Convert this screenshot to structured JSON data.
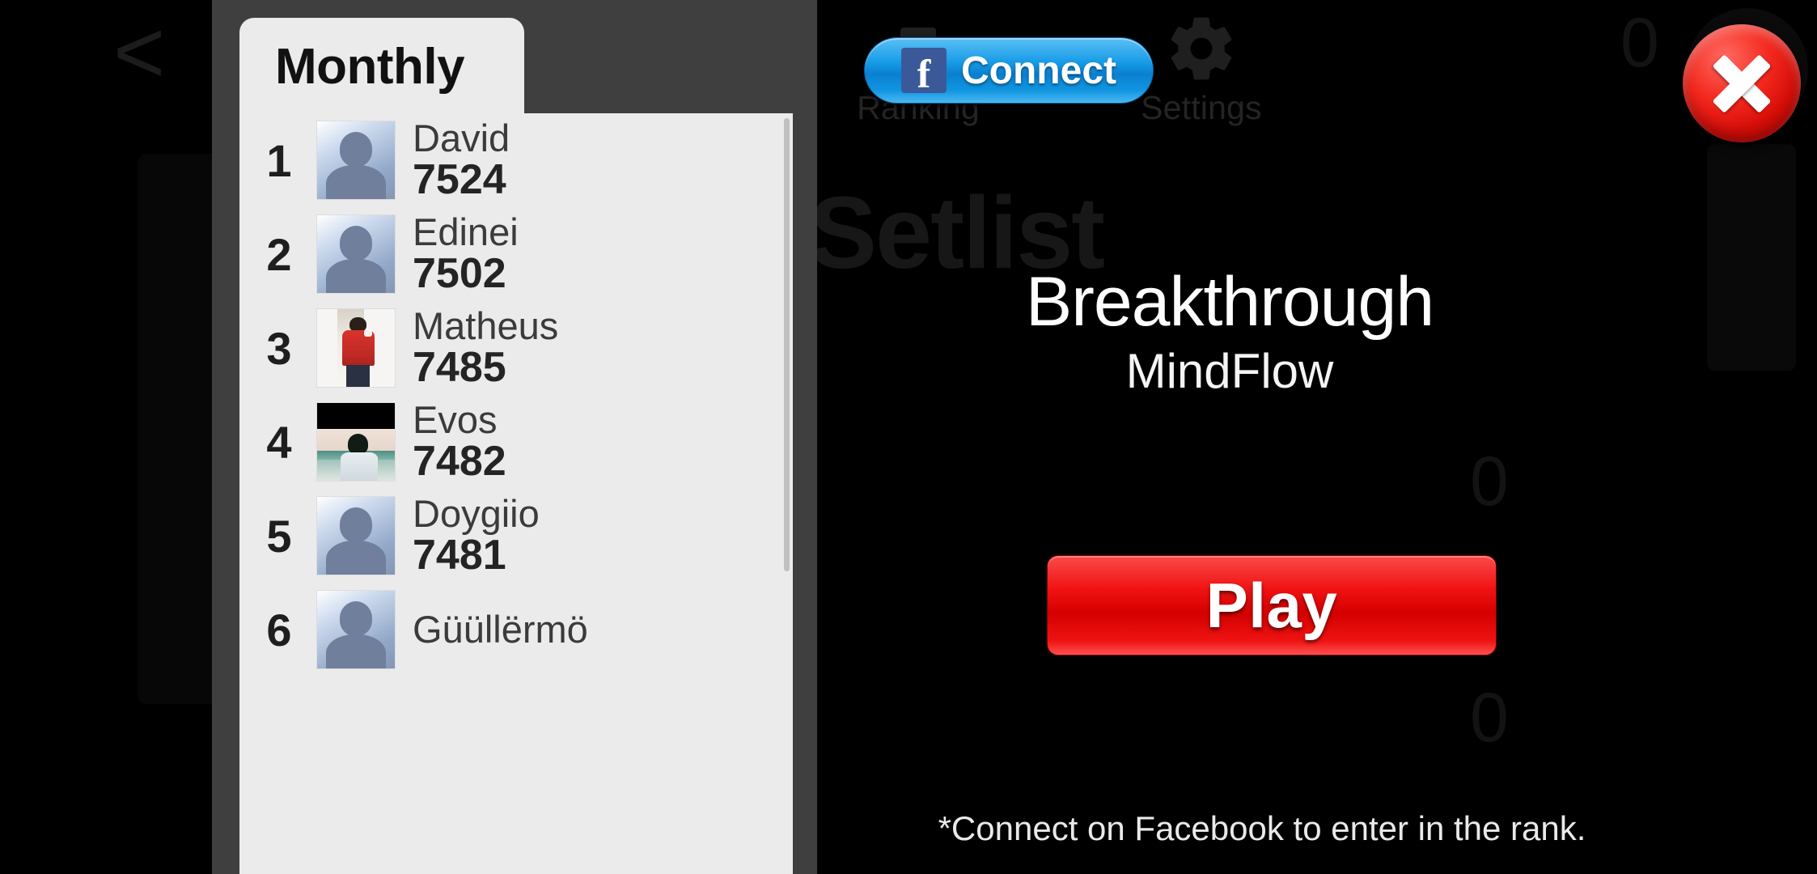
{
  "background": {
    "back_icon": "back-chevron-icon",
    "back_glyph": "<",
    "setlist_heading": "Setlist",
    "ghost_tabs": [
      {
        "label": "Ranking",
        "icon": "trophy-icon"
      },
      {
        "label": "Settings",
        "icon": "gear-icon"
      }
    ],
    "ghost_counters": [
      "0",
      "0",
      "0"
    ]
  },
  "header": {
    "facebook_connect_label": "Connect",
    "facebook_icon": "facebook-f-icon",
    "close_icon": "close-x-icon"
  },
  "song": {
    "title": "Breakthrough",
    "artist": "MindFlow"
  },
  "actions": {
    "play_label": "Play",
    "play_color": "#e81010"
  },
  "footer": {
    "note": "*Connect on Facebook to enter in the rank."
  },
  "leaderboard": {
    "tab_label": "Monthly",
    "panel_bg": "#ebebeb",
    "frame_bg": "#3f3f3f",
    "entries": [
      {
        "rank": "1",
        "name": "David",
        "score": "7524",
        "avatar": "default"
      },
      {
        "rank": "2",
        "name": "Edinei",
        "score": "7502",
        "avatar": "default"
      },
      {
        "rank": "3",
        "name": "Matheus",
        "score": "7485",
        "avatar": "matheus"
      },
      {
        "rank": "4",
        "name": "Evos",
        "score": "7482",
        "avatar": "evos"
      },
      {
        "rank": "5",
        "name": "Doygiio",
        "score": "7481",
        "avatar": "default"
      },
      {
        "rank": "6",
        "name": "Güüllërmö",
        "score": "",
        "avatar": "default"
      }
    ]
  }
}
